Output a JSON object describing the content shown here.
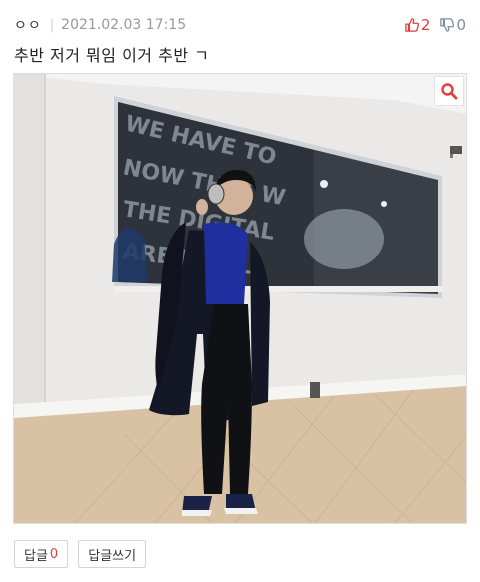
{
  "post": {
    "author": "ㅇㅇ",
    "separator": "|",
    "date": "2021.02.03 17:15",
    "title": "추반 저거 뭐임 이거 추반 ㄱ",
    "upvotes": "2",
    "downvotes": "0"
  },
  "photo": {
    "alt": "Person in a long navy coat standing in a white room with a large window"
  },
  "actions": {
    "reply_label": "답글",
    "reply_count": "0",
    "write_reply_label": "답글쓰기"
  },
  "icons": {
    "upvote": "thumbs-up-icon",
    "downvote": "thumbs-down-icon",
    "zoom": "magnifier-icon"
  },
  "colors": {
    "accent": "#e0403a",
    "downvote": "#7a8ea6",
    "meta_gray": "#999999"
  }
}
